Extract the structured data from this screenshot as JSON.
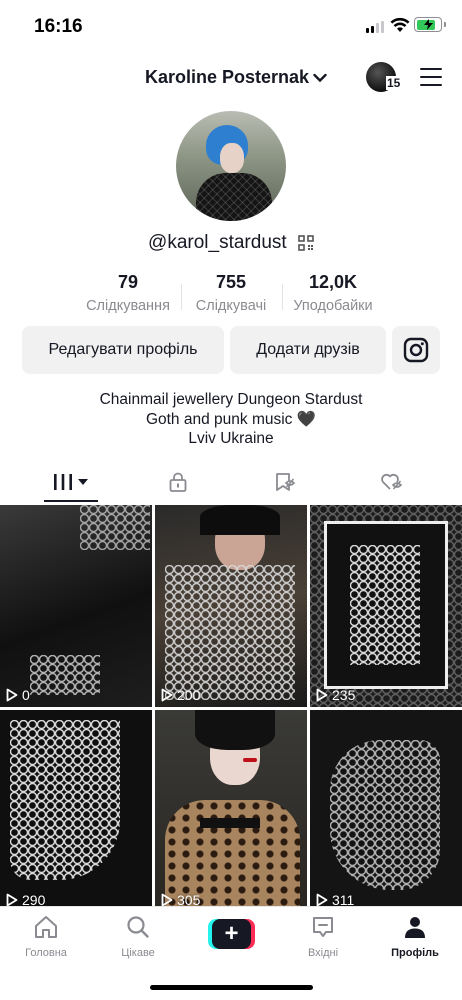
{
  "status_bar": {
    "time": "16:16"
  },
  "header": {
    "username": "Karoline Posternak",
    "story_badge": "15"
  },
  "profile": {
    "handle": "@karol_stardust"
  },
  "stats": [
    {
      "value": "79",
      "label": "Слідкування"
    },
    {
      "value": "755",
      "label": "Слідкувачі"
    },
    {
      "value": "12,0K",
      "label": "Уподобайки"
    }
  ],
  "buttons": {
    "edit_profile": "Редагувати профіль",
    "add_friends": "Додати друзів"
  },
  "bio": {
    "line1": "Chainmail jewellery Dungeon Stardust",
    "line2": "Goth and punk music 🖤",
    "line3": "Lviv Ukraine"
  },
  "videos": [
    {
      "views": "0"
    },
    {
      "views": "200"
    },
    {
      "views": "235"
    },
    {
      "views": "290"
    },
    {
      "views": "305"
    },
    {
      "views": "311"
    }
  ],
  "nav": {
    "home": "Головна",
    "discover": "Цікаве",
    "create": "+",
    "inbox": "Вхідні",
    "profile": "Профіль"
  },
  "colors": {
    "accent_cyan": "#25f4ee",
    "accent_red": "#fe2c55",
    "battery": "#34c759"
  }
}
